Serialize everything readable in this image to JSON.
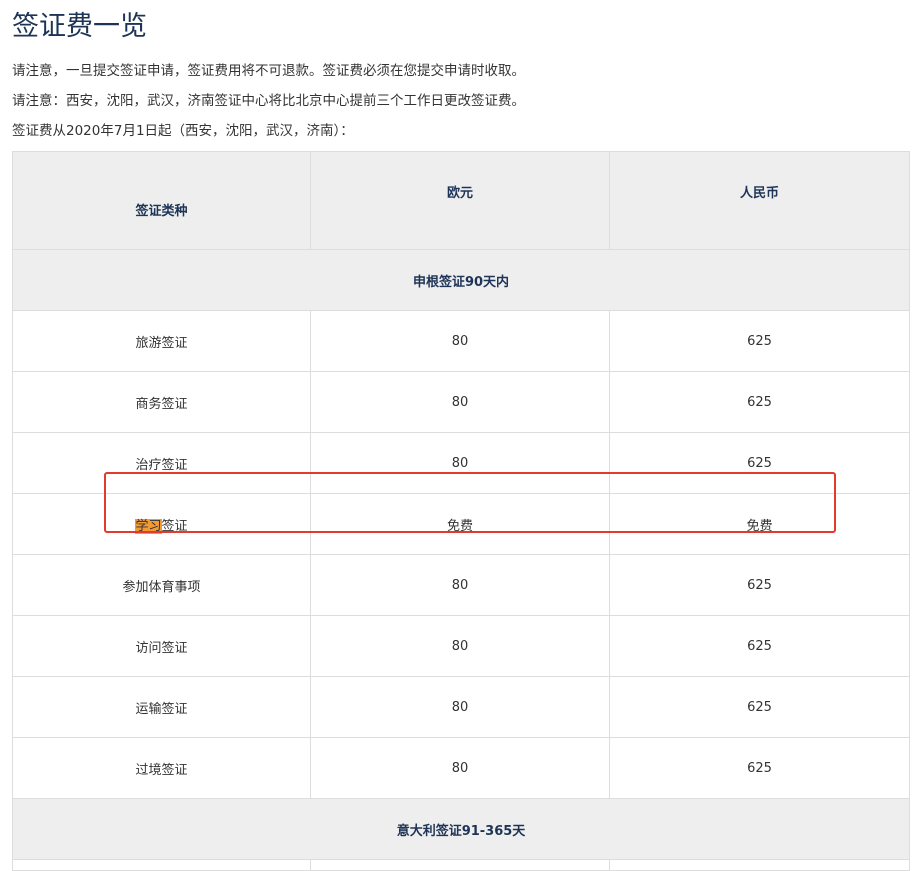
{
  "header": {
    "title": "签证费一览"
  },
  "notes": {
    "note_1": "请注意，一旦提交签证申请，签证费用将不可退款。签证费必须在您提交申请时收取。",
    "note_2": "请注意：西安，沈阳，武汉，济南签证中心将比北京中心提前三个工作日更改签证费。",
    "note_3": "签证费从2020年7月1日起（西安，沈阳，武汉，济南）："
  },
  "table": {
    "headers": [
      "签证类种",
      "欧元",
      "人民币"
    ],
    "section_1": {
      "title": "申根签证90天内",
      "rows": [
        {
          "type": "旅游签证",
          "euro": "80",
          "rmb": "625"
        },
        {
          "type": "商务签证",
          "euro": "80",
          "rmb": "625"
        },
        {
          "type": "治疗签证",
          "euro": "80",
          "rmb": "625"
        },
        {
          "type_highlight": "学习",
          "type_rest": "签证",
          "euro": "免费",
          "rmb": "免费"
        },
        {
          "type": "参加体育事项",
          "euro": "80",
          "rmb": "625"
        },
        {
          "type": "访问签证",
          "euro": "80",
          "rmb": "625"
        },
        {
          "type": "运输签证",
          "euro": "80",
          "rmb": "625"
        },
        {
          "type": "过境签证",
          "euro": "80",
          "rmb": "625"
        }
      ]
    },
    "section_2": {
      "title": "意大利签证91-365天"
    }
  },
  "colors": {
    "title_navy": "#1d3456",
    "header_bg": "#eeeeee",
    "border": "#dddddd",
    "highlight_orange": "#f39a35",
    "annotation_red": "#e23b2e"
  }
}
